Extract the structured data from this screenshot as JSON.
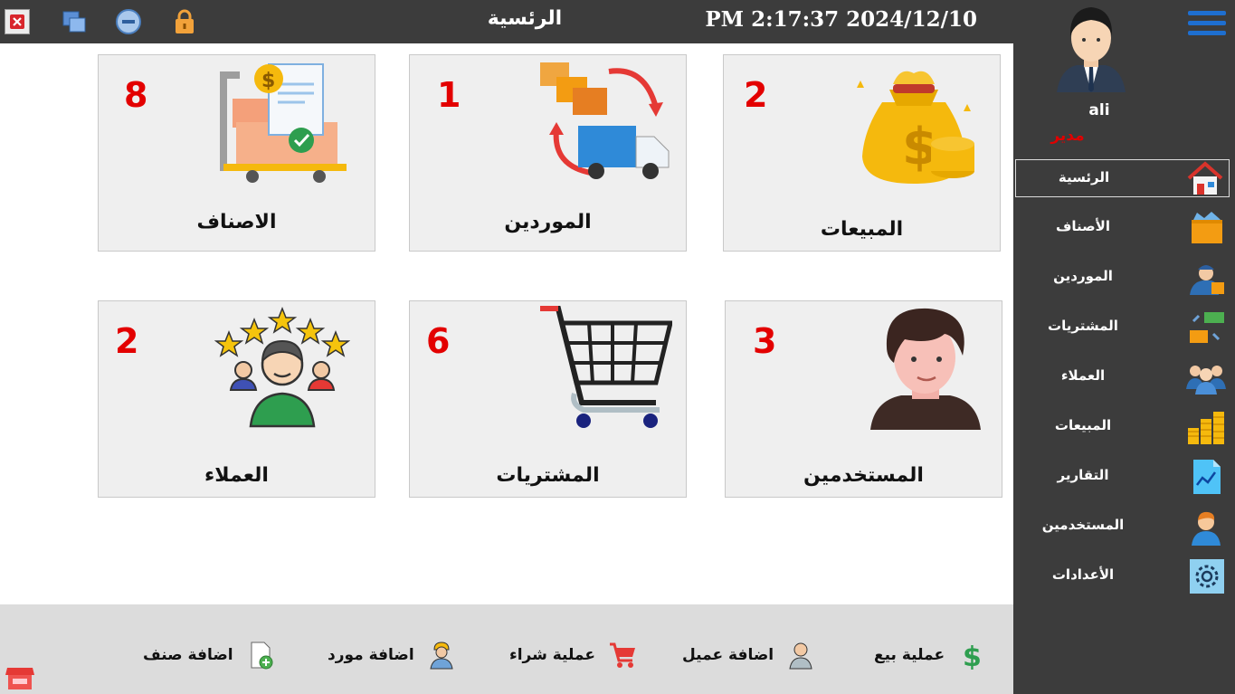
{
  "topbar": {
    "title": "الرئسية",
    "datetime": "PM 2:17:37 2024/12/10",
    "buttons": [
      "close-icon",
      "restore-icon",
      "minimize-icon",
      "lock-icon"
    ]
  },
  "user": {
    "name": "ali",
    "role": "مدير"
  },
  "sidebar": {
    "items": [
      {
        "label": "الرئسية",
        "icon": "home-icon",
        "active": true
      },
      {
        "label": "الأصناف",
        "icon": "box-icon"
      },
      {
        "label": "الموردين",
        "icon": "supplier-icon"
      },
      {
        "label": "المشتريات",
        "icon": "purchases-icon"
      },
      {
        "label": "العملاء",
        "icon": "customers-icon"
      },
      {
        "label": "المبيعات",
        "icon": "coins-icon"
      },
      {
        "label": "التقارير",
        "icon": "report-icon"
      },
      {
        "label": "المستخدمين",
        "icon": "user-icon"
      },
      {
        "label": "الأعدادات",
        "icon": "settings-icon"
      }
    ]
  },
  "tiles": [
    {
      "label": "المبيعات",
      "count": "2",
      "icon": "money-bag-icon"
    },
    {
      "label": "الموردين",
      "count": "1",
      "icon": "delivery-truck-icon"
    },
    {
      "label": "الاصناف",
      "count": "8",
      "icon": "inventory-cart-icon"
    },
    {
      "label": "المستخدمين",
      "count": "3",
      "icon": "user-portrait-icon"
    },
    {
      "label": "المشتريات",
      "count": "6",
      "icon": "shopping-cart-icon"
    },
    {
      "label": "العملاء",
      "count": "2",
      "icon": "customers-rating-icon"
    }
  ],
  "quick_actions": [
    {
      "label": "عملية بيع",
      "icon": "dollar-icon"
    },
    {
      "label": "اضافة عميل",
      "icon": "add-customer-icon"
    },
    {
      "label": "عملية شراء",
      "icon": "cart-icon"
    },
    {
      "label": "اضافة مورد",
      "icon": "add-supplier-icon"
    },
    {
      "label": "اضافة صنف",
      "icon": "add-item-icon"
    }
  ],
  "colors": {
    "dark": "#3c3c3c",
    "count_red": "#e30000",
    "tile_bg": "#efefef",
    "bottom_bg": "#dcdcdc",
    "accent_blue": "#1e6fd0"
  }
}
